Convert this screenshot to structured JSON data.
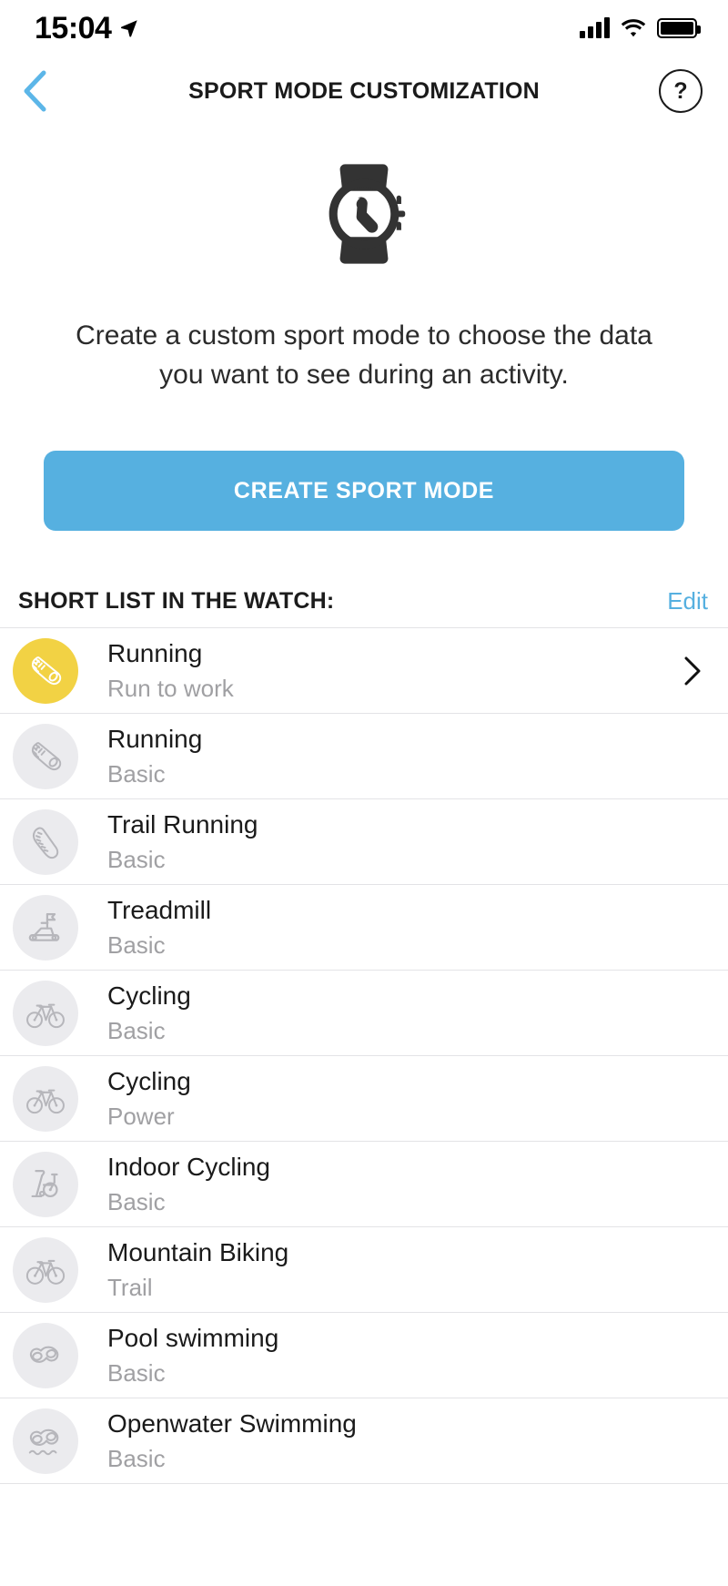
{
  "status_bar": {
    "time": "15:04",
    "location_icon": "location-arrow-icon",
    "signal_icon": "cellular-signal-icon",
    "wifi_icon": "wifi-icon",
    "battery_icon": "battery-full-icon"
  },
  "nav": {
    "back_icon": "chevron-left-icon",
    "title": "SPORT MODE CUSTOMIZATION",
    "help_label": "?"
  },
  "hero": {
    "watch_icon": "smartwatch-icon",
    "description": "Create a custom sport mode to choose the data you want to see during an activity.",
    "cta_label": "CREATE SPORT MODE"
  },
  "section": {
    "title": "SHORT LIST IN THE WATCH:",
    "action_label": "Edit"
  },
  "colors": {
    "accent_blue": "#56b0e0",
    "accent_yellow": "#f2d244",
    "icon_bg": "#ebebee",
    "icon_grey": "#b6b6bb",
    "subtitle_grey": "#a0a0a3",
    "divider": "#e3e3e6"
  },
  "sports": [
    {
      "title": "Running",
      "subtitle": "Run to work",
      "icon": "running-shoe-icon",
      "highlighted": true,
      "chevron": "chevron-right-icon"
    },
    {
      "title": "Running",
      "subtitle": "Basic",
      "icon": "running-shoe-icon",
      "highlighted": false
    },
    {
      "title": "Trail Running",
      "subtitle": "Basic",
      "icon": "trail-shoe-sole-icon",
      "highlighted": false
    },
    {
      "title": "Treadmill",
      "subtitle": "Basic",
      "icon": "treadmill-icon",
      "highlighted": false
    },
    {
      "title": "Cycling",
      "subtitle": "Basic",
      "icon": "bicycle-icon",
      "highlighted": false
    },
    {
      "title": "Cycling",
      "subtitle": "Power",
      "icon": "bicycle-icon",
      "highlighted": false
    },
    {
      "title": "Indoor Cycling",
      "subtitle": "Basic",
      "icon": "spin-bike-icon",
      "highlighted": false
    },
    {
      "title": "Mountain Biking",
      "subtitle": "Trail",
      "icon": "mountain-bike-icon",
      "highlighted": false
    },
    {
      "title": "Pool swimming",
      "subtitle": "Basic",
      "icon": "swim-goggles-icon",
      "highlighted": false
    },
    {
      "title": "Openwater Swimming",
      "subtitle": "Basic",
      "icon": "swim-goggles-waves-icon",
      "highlighted": false
    }
  ]
}
